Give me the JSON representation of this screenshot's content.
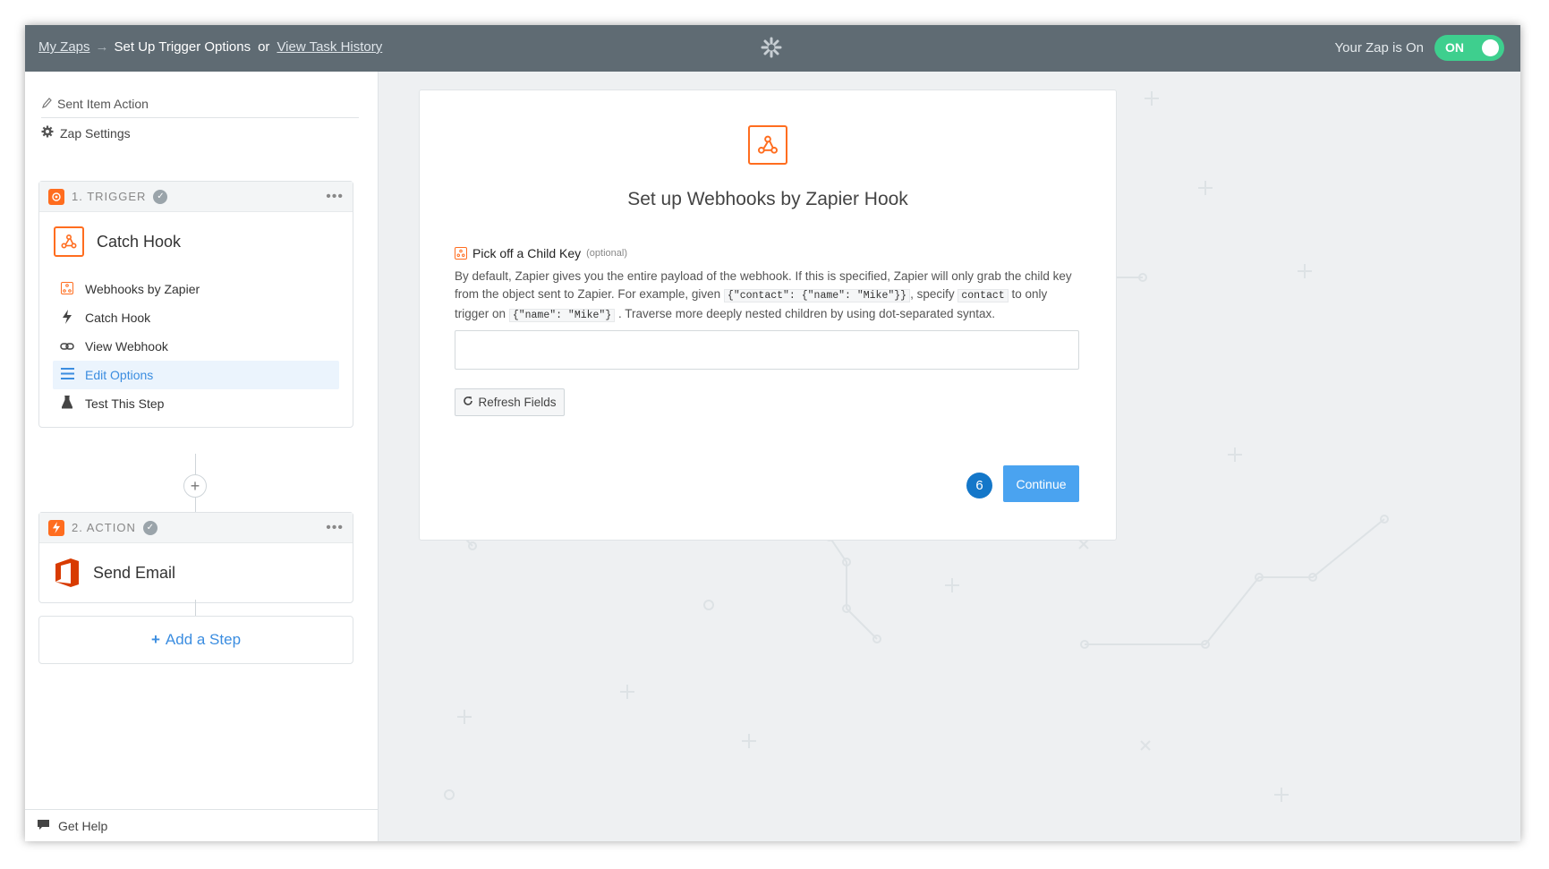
{
  "topbar": {
    "my_zaps": "My Zaps",
    "arrow": "→",
    "current": "Set Up Trigger Options",
    "or": "or",
    "task_history": "View Task History",
    "status_label": "Your Zap is On",
    "toggle_label": "ON"
  },
  "sidebar": {
    "zap_name": "Sent Item Action",
    "zap_settings": "Zap Settings",
    "trigger": {
      "number_label": "1. TRIGGER",
      "app_name": "Catch Hook",
      "items": [
        {
          "label": "Webhooks by Zapier",
          "icon": "webhook-icon"
        },
        {
          "label": "Catch Hook",
          "icon": "bolt-icon"
        },
        {
          "label": "View Webhook",
          "icon": "link-icon"
        },
        {
          "label": "Edit Options",
          "icon": "list-icon",
          "active": true
        },
        {
          "label": "Test This Step",
          "icon": "flask-icon"
        }
      ]
    },
    "action": {
      "number_label": "2. ACTION",
      "app_name": "Send Email"
    },
    "add_step": "Add a Step",
    "get_help": "Get Help"
  },
  "panel": {
    "title": "Set up Webhooks by Zapier Hook",
    "field_label": "Pick off a Child Key",
    "field_optional": "(optional)",
    "help_1": "By default, Zapier gives you the entire payload of the webhook. If this is specified, Zapier will only grab the child key from the object sent to Zapier. For example, given",
    "code_1": "{\"contact\": {\"name\": \"Mike\"}}",
    "help_2": ", specify",
    "code_2": "contact",
    "help_3": "to only trigger on",
    "code_3": "{\"name\": \"Mike\"}",
    "help_4": ". Traverse more deeply nested children by using dot-separated syntax.",
    "input_value": "",
    "refresh_label": "Refresh Fields",
    "step_badge": "6",
    "continue_label": "Continue"
  },
  "colors": {
    "topbar": "#5f6b73",
    "toggle_on": "#3ecf8e",
    "zapier_orange": "#ff6d1f",
    "office_red": "#d83b01",
    "link_blue": "#3b8de0",
    "continue_blue": "#4aa3f0",
    "badge_blue": "#1477c9"
  }
}
